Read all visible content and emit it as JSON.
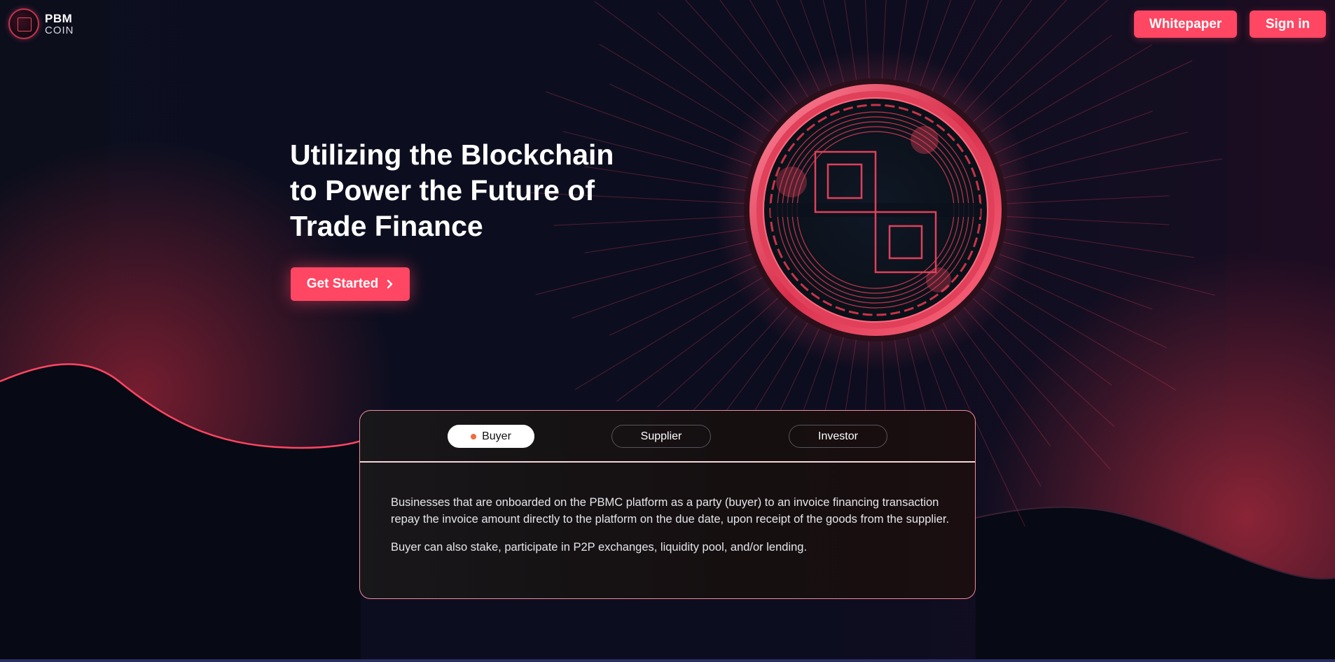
{
  "brand": {
    "line1": "PBM",
    "line2": "COIN"
  },
  "nav": {
    "whitepaper_label": "Whitepaper",
    "signin_label": "Sign in"
  },
  "hero": {
    "title_lines": [
      "Utilizing the Blockchain",
      "to Power the Future of",
      "Trade Finance"
    ],
    "cta_label": "Get Started",
    "cta_icon": "chevron-right-icon"
  },
  "roles": {
    "tabs": [
      {
        "label": "Buyer",
        "selected": true
      },
      {
        "label": "Supplier",
        "selected": false
      },
      {
        "label": "Investor",
        "selected": false
      }
    ],
    "description": [
      "Businesses that are onboarded on the PBMC platform as a party (buyer) to an invoice financing transaction repay the invoice amount directly to the platform on the due date, upon receipt of the goods from the supplier.",
      "Buyer can also stake, participate in P2P exchanges, liquidity pool, and/or lending."
    ]
  },
  "colors": {
    "accent": "#ff4662",
    "background": "#080a16",
    "card_border": "#f38c9a",
    "selected_dot": "#f26a3c"
  }
}
